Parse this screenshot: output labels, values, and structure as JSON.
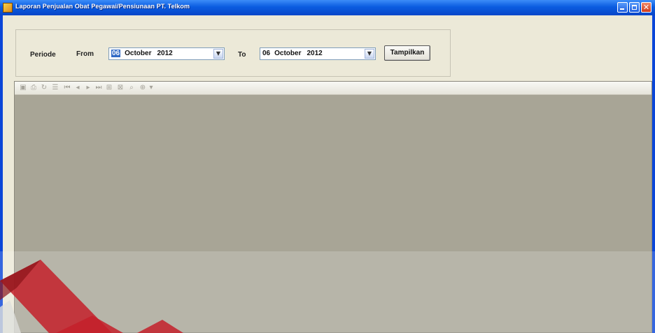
{
  "window": {
    "title": "Laporan Penjualan Obat Pegawai/Pensiunaan PT. Telkom",
    "close_glyph": "✕"
  },
  "filter": {
    "periode_label": "Periode",
    "from_label": "From",
    "to_label": "To",
    "from_date": {
      "day": "06",
      "month": "October",
      "year": "2012"
    },
    "to_date": {
      "day": "06",
      "month": "October",
      "year": "2012"
    },
    "dropdown_glyph": "▼",
    "submit_label": "Tampilkan"
  },
  "viewer": {
    "toolbar_icons": [
      {
        "name": "export-icon",
        "glyph": "▣"
      },
      {
        "name": "print-icon",
        "glyph": "⎙"
      },
      {
        "name": "refresh-icon",
        "glyph": "↻"
      },
      {
        "name": "group-tree-icon",
        "glyph": "☰"
      },
      {
        "name": "first-page-icon",
        "glyph": "⏮"
      },
      {
        "name": "previous-page-icon",
        "glyph": "◂"
      },
      {
        "name": "next-page-icon",
        "glyph": "▸"
      },
      {
        "name": "last-page-icon",
        "glyph": "⏭"
      },
      {
        "name": "go-to-page-icon",
        "glyph": "⊞"
      },
      {
        "name": "stop-icon",
        "glyph": "⊠"
      },
      {
        "name": "search-icon",
        "glyph": "⌕"
      },
      {
        "name": "zoom-icon",
        "glyph": "⊕"
      },
      {
        "name": "zoom-dropdown-icon",
        "glyph": "▾"
      }
    ]
  },
  "colors": {
    "titlebar": "#0a5ce0",
    "viewer_background": "#a8a596",
    "watermark_red": "#c4202a"
  }
}
